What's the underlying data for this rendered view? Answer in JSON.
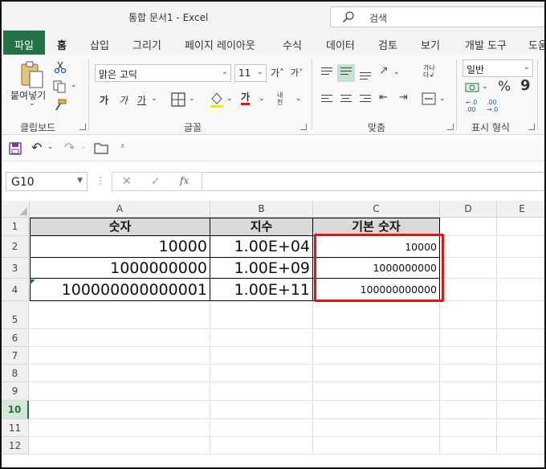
{
  "window": {
    "title": "통합 문서1  -  Excel",
    "search_placeholder": "검색"
  },
  "tabs": [
    "파일",
    "홈",
    "삽입",
    "그리기",
    "페이지 레이아웃",
    "수식",
    "데이터",
    "검토",
    "보기",
    "개발 도구",
    "도움"
  ],
  "ribbon": {
    "clipboard": {
      "paste_label": "붙여넣기",
      "group_label": "클립보드"
    },
    "font": {
      "font_name": "맑은 고딕",
      "font_size": "11",
      "bold": "가",
      "italic": "가",
      "underline": "가",
      "font_color_glyph": "가",
      "phonetic": "내천",
      "group_label": "글꼴"
    },
    "alignment": {
      "group_label": "맞춤"
    },
    "number": {
      "format": "일반",
      "group_label": "표시 형식",
      "percent": "%",
      "comma": "9"
    }
  },
  "formula_bar": {
    "name_box": "G10",
    "fx": "fx",
    "formula": ""
  },
  "grid": {
    "columns": [
      "A",
      "B",
      "C",
      "D",
      "E"
    ],
    "rows": [
      "1",
      "2",
      "3",
      "4",
      "5",
      "6",
      "7",
      "8",
      "9",
      "10",
      "11",
      "12"
    ],
    "selected_row": "10",
    "cells": {
      "A1": "숫자",
      "B1": "지수",
      "C1": "기본 숫자",
      "A2": "10000",
      "B2": "1.00E+04",
      "C2": "10000",
      "A3": "1000000000",
      "B3": "1.00E+09",
      "C3": "1000000000",
      "A4": "100000000000001",
      "B4": "1.00E+11",
      "C4": "100000000000"
    }
  },
  "colors": {
    "excel_green": "#217346",
    "highlight_red": "#e81010",
    "header_fill": "#d9d9d9"
  }
}
